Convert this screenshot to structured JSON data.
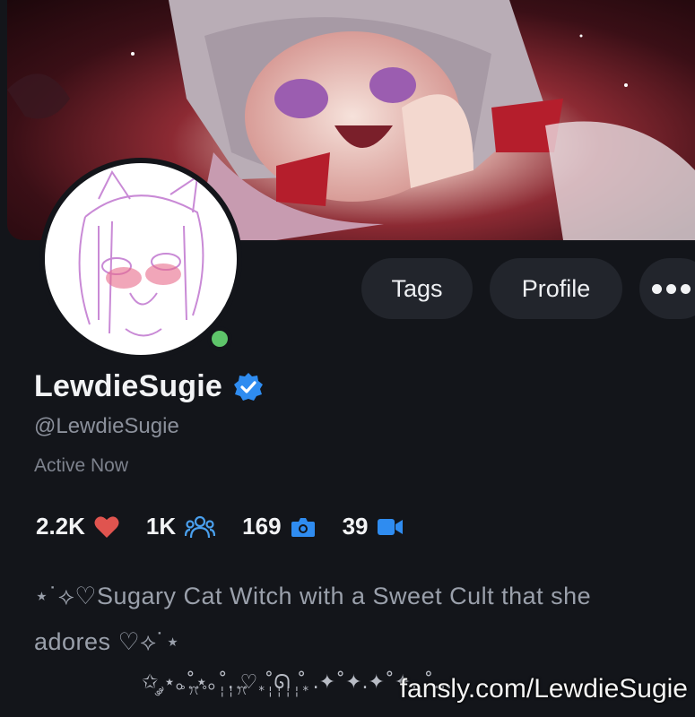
{
  "banner": {
    "alt": "profile banner artwork"
  },
  "avatar": {
    "alt": "profile avatar sketch"
  },
  "actions": {
    "tags_label": "Tags",
    "profile_label": "Profile",
    "more_icon": "more-horizontal-icon"
  },
  "profile": {
    "display_name": "LewdieSugie",
    "handle": "@LewdieSugie",
    "status": "Active Now",
    "verified_icon": "verified-badge-icon",
    "online_color": "#5ec56a"
  },
  "stats": {
    "likes": "2.2K",
    "likes_icon": "heart-icon",
    "followers": "1K",
    "followers_icon": "users-icon",
    "photos": "169",
    "photos_icon": "camera-icon",
    "videos": "39",
    "videos_icon": "video-camera-icon"
  },
  "bio": {
    "line1": "⋆˙⟡♡Sugary Cat Witch with a Sweet Cult that she",
    "line2": "adores ♡⟡˙⋆",
    "decoration": "✩ ༘⋆｡˚⋆｡˚. ♡ ˚ᘏ ˚ .✦˚✦.✦˚✦. ˚..."
  },
  "watermark": "fansly.com/LewdieSugie",
  "colors": {
    "background": "#13151a",
    "accent": "#2f8cf0",
    "heart": "#e0544f"
  }
}
